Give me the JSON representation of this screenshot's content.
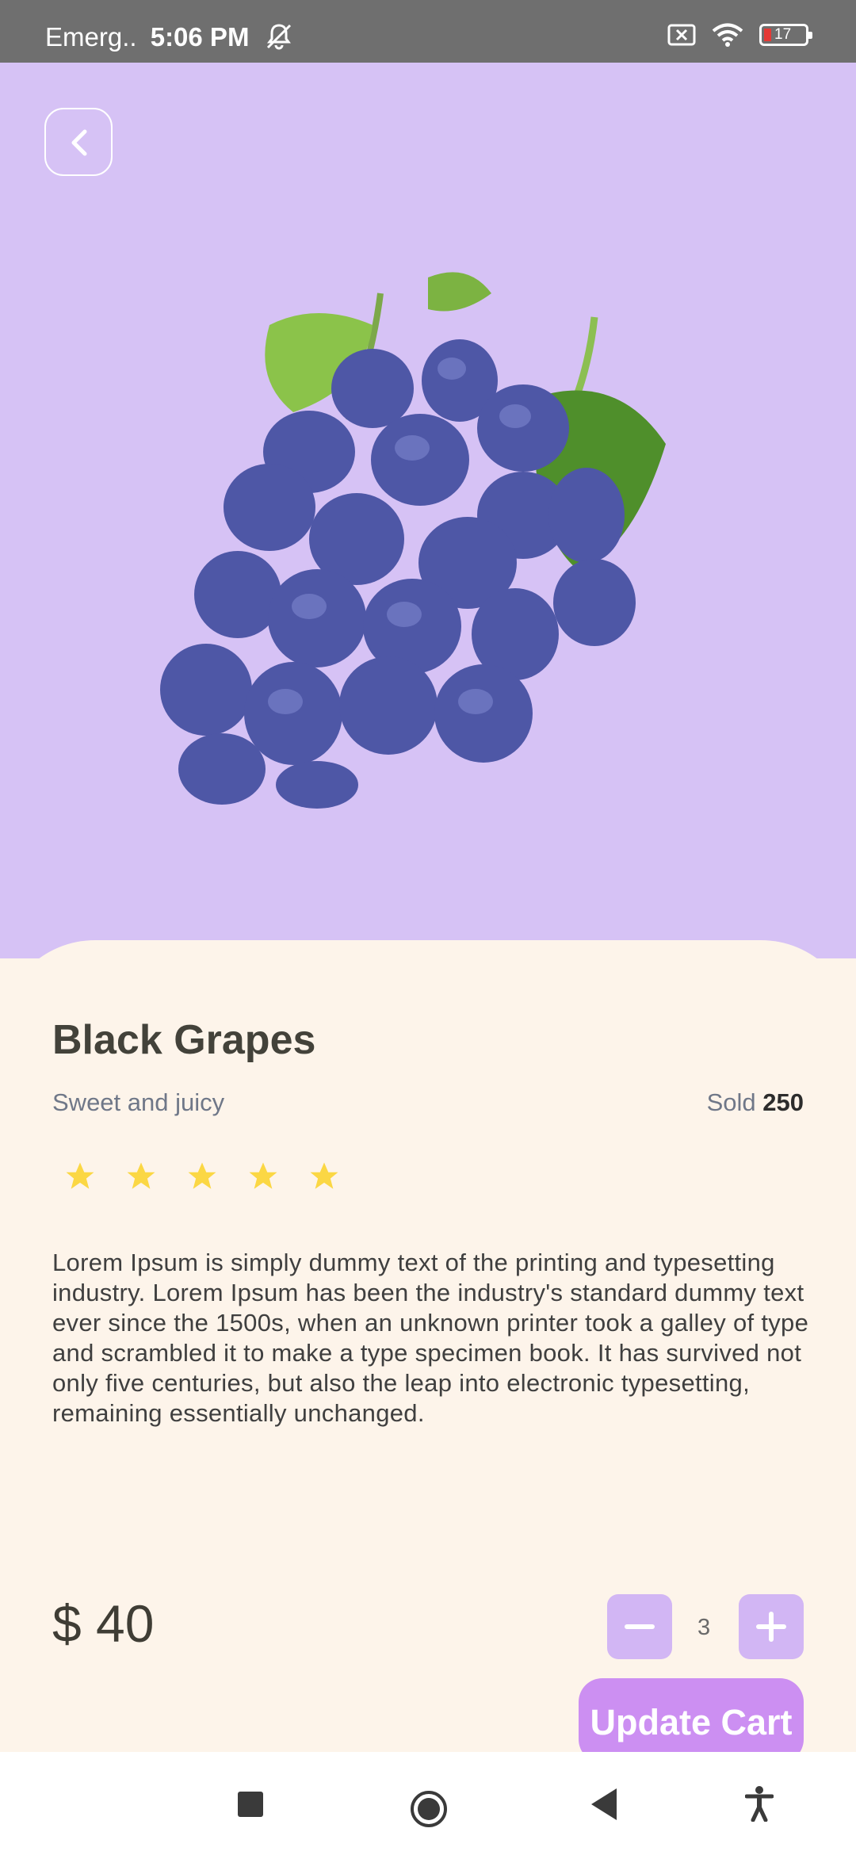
{
  "status_bar": {
    "carrier": "Emerg..",
    "time": "5:06 PM",
    "battery_level": "17",
    "icons": [
      "muted-bell-icon",
      "sim-off-icon",
      "wifi-icon",
      "battery-icon"
    ]
  },
  "product": {
    "image": "black-grapes-image",
    "name": "Black Grapes",
    "tagline": "Sweet and juicy",
    "sold_label": "Sold",
    "sold_count": "250",
    "rating_stars": 5,
    "star_color": "#fbd744",
    "description": "Lorem Ipsum is simply dummy text of the printing and typesetting industry. Lorem Ipsum has been the industry's standard dummy text ever since the 1500s, when an unknown printer took a galley of type and scrambled it to make a type specimen book. It has survived not only five centuries, but also the leap into electronic typesetting, remaining essentially unchanged.",
    "price": "$ 40"
  },
  "cart": {
    "quantity": "3",
    "update_label": "Update Cart"
  },
  "colors": {
    "hero_background": "#d6c2f5",
    "sheet_background": "#fdf4ea",
    "accent": "#cc8ff2",
    "stepper": "#d2b6f4"
  }
}
